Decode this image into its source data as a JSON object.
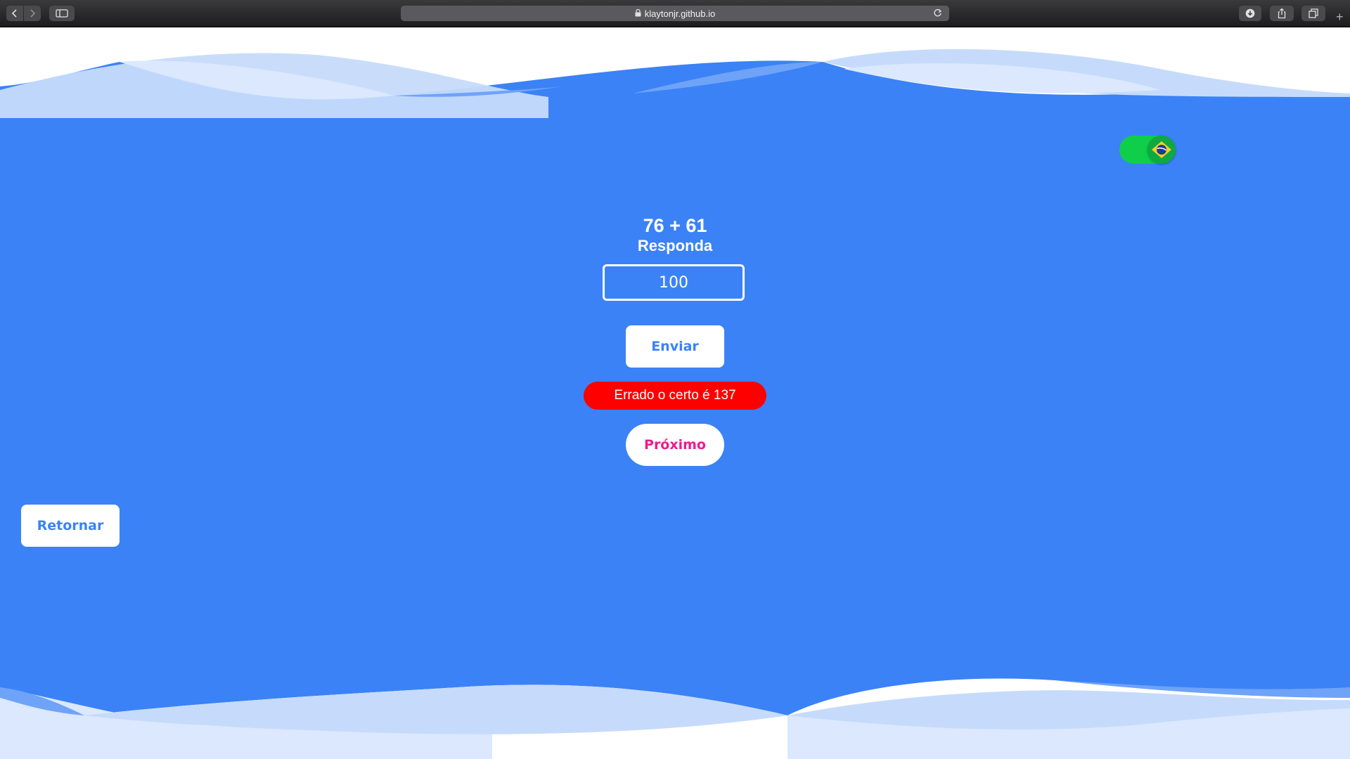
{
  "browser": {
    "url": "klaytonjr.github.io"
  },
  "page": {
    "question": "76 + 61",
    "prompt": "Responda",
    "answer_value": "100",
    "submit_label": "Enviar",
    "result_text": "Errado o certo é 137",
    "next_label": "Próximo",
    "return_label": "Retornar",
    "language_toggle_icon": "brazil-flag-icon"
  },
  "colors": {
    "background": "#3b82f6",
    "result_badge": "#ff0000",
    "next_text": "#ee1a8f",
    "toggle": "#0fcf4a"
  }
}
